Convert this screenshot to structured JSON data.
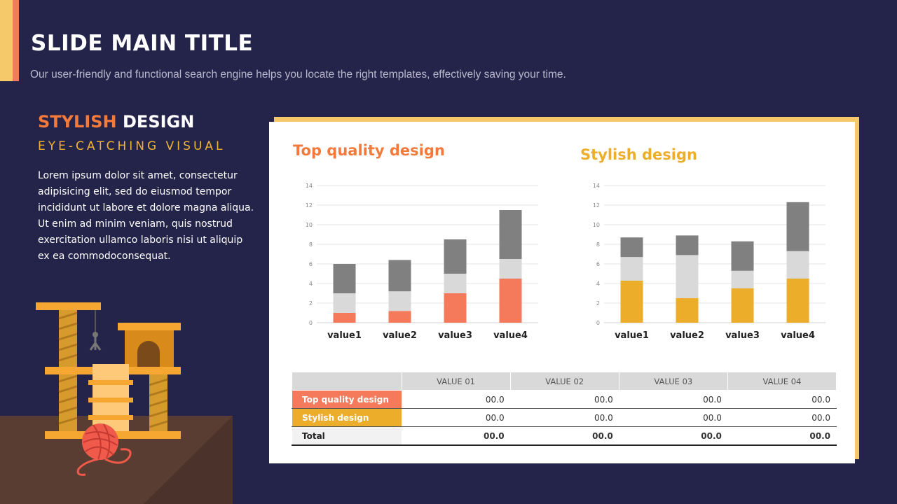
{
  "slide": {
    "title": "SLIDE MAIN TITLE",
    "subtitle": "Our user-friendly and functional search engine helps you locate the right templates, effectively saving your time."
  },
  "left": {
    "heading_a": "STYLISH",
    "heading_b": "DESIGN",
    "eyebrow": "EYE-CATCHING  VISUAL",
    "body": "Lorem ipsum dolor sit amet, consectetur adipisicing elit, sed do eiusmod tempor incididunt ut labore et dolore magna aliqua. Ut enim ad minim veniam, quis nostrud exercitation ullamco laboris nisi ut aliquip ex ea commodoconsequat."
  },
  "colors": {
    "background": "#24234a",
    "coral": "#f47a5b",
    "gold": "#ecad2a",
    "light_gray": "#d9d9d9",
    "dark_gray": "#808080",
    "title_orange": "#f47a3c",
    "title_gold": "#ecad2a"
  },
  "illustration": {
    "icon": "cat-tree-with-yarn-ball-icon"
  },
  "chart_data": [
    {
      "type": "bar",
      "stacked": true,
      "title": "Top quality design",
      "categories": [
        "value1",
        "value2",
        "value3",
        "value4"
      ],
      "series": [
        {
          "values": [
            1.0,
            1.2,
            3.0,
            4.5
          ],
          "color": "#f47a5b"
        },
        {
          "values": [
            2.0,
            2.0,
            2.0,
            2.0
          ],
          "color": "#d9d9d9"
        },
        {
          "values": [
            3.0,
            3.2,
            3.5,
            5.0
          ],
          "color": "#808080"
        }
      ],
      "ylim": [
        0,
        14
      ],
      "yticks": [
        0,
        2,
        4,
        6,
        8,
        10,
        12,
        14
      ],
      "grid": true,
      "legend": "none"
    },
    {
      "type": "bar",
      "stacked": true,
      "title": "Stylish design",
      "categories": [
        "value1",
        "value2",
        "value3",
        "value4"
      ],
      "series": [
        {
          "values": [
            4.3,
            2.5,
            3.5,
            4.5
          ],
          "color": "#ecad2a"
        },
        {
          "values": [
            2.4,
            4.4,
            1.8,
            2.8
          ],
          "color": "#d9d9d9"
        },
        {
          "values": [
            2.0,
            2.0,
            3.0,
            5.0
          ],
          "color": "#808080"
        }
      ],
      "ylim": [
        0,
        14
      ],
      "yticks": [
        0,
        2,
        4,
        6,
        8,
        10,
        12,
        14
      ],
      "grid": true,
      "legend": "none"
    }
  ],
  "table": {
    "headers": [
      "VALUE 01",
      "VALUE 02",
      "VALUE 03",
      "VALUE 04"
    ],
    "rows": [
      {
        "label": "Top quality design",
        "values": [
          "00.0",
          "00.0",
          "00.0",
          "00.0"
        ],
        "color": "#f47a5b"
      },
      {
        "label": "Stylish design",
        "values": [
          "00.0",
          "00.0",
          "00.0",
          "00.0"
        ],
        "color": "#ecad2a"
      },
      {
        "label": "Total",
        "values": [
          "00.0",
          "00.0",
          "00.0",
          "00.0"
        ]
      }
    ]
  }
}
